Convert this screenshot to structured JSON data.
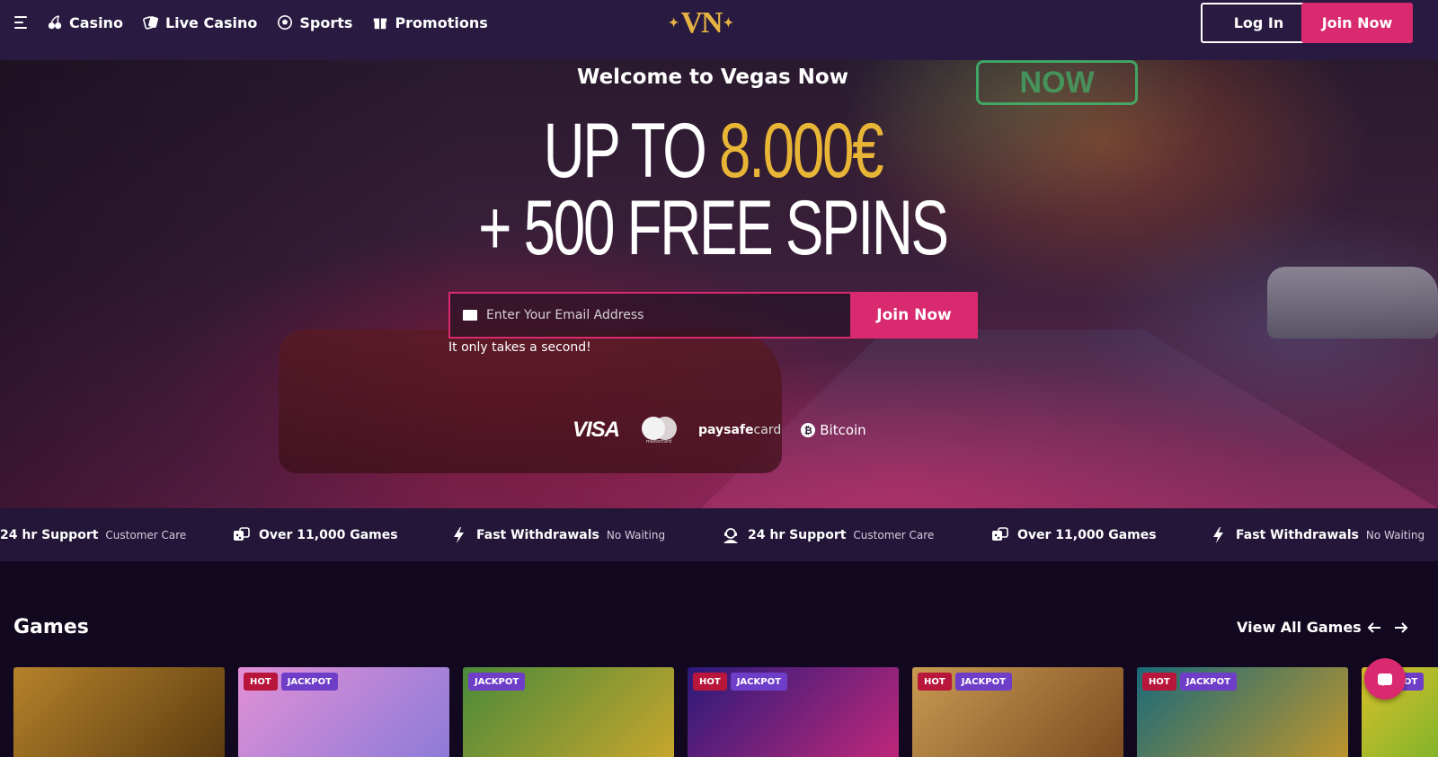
{
  "header": {
    "menu_icon": "hamburger-icon",
    "nav": [
      {
        "label": "Casino",
        "icon": "cherries-icon"
      },
      {
        "label": "Live Casino",
        "icon": "cards-icon"
      },
      {
        "label": "Sports",
        "icon": "soccer-ball-icon"
      },
      {
        "label": "Promotions",
        "icon": "gift-icon"
      }
    ],
    "logo": "VN",
    "login_label": "Log In",
    "join_label": "Join Now"
  },
  "hero": {
    "welcome": "Welcome to Vegas Now",
    "line1_prefix": "UP TO ",
    "line1_amount": "8.000€",
    "line2": "+ 500 FREE SPINS",
    "email_placeholder": "Enter Your Email Address",
    "join_label": "Join Now",
    "hint": "It only takes a second!",
    "neon_sign": "NOW",
    "payments": {
      "visa": "VISA",
      "mastercard": "mastercard",
      "paysafecard_bold": "paysafe",
      "paysafecard_light": "card",
      "bitcoin": "Bitcoin"
    }
  },
  "features": [
    {
      "title": "24 hr Support",
      "sub": "Customer Care",
      "icon": "support-agent-icon"
    },
    {
      "title": "Over 11,000 Games",
      "sub": "",
      "icon": "dice-icon"
    },
    {
      "title": "Fast Withdrawals",
      "sub": "No Waiting",
      "icon": "lightning-icon"
    },
    {
      "title": "24 hr Support",
      "sub": "Customer Care",
      "icon": "support-agent-icon"
    },
    {
      "title": "Over 11,000 Games",
      "sub": "",
      "icon": "dice-icon"
    },
    {
      "title": "Fast Withdrawals",
      "sub": "No Waiting",
      "icon": "lightning-icon"
    }
  ],
  "games": {
    "title": "Games",
    "view_all": "View All Games",
    "cards": [
      {
        "badges": [],
        "colors": [
          "#b5822b",
          "#5a3a10"
        ]
      },
      {
        "badges": [
          "HOT",
          "JACKPOT"
        ],
        "colors": [
          "#e290d6",
          "#8a7ad8"
        ]
      },
      {
        "badges": [
          "JACKPOT"
        ],
        "colors": [
          "#4a8a3a",
          "#caa62c"
        ]
      },
      {
        "badges": [
          "HOT",
          "JACKPOT"
        ],
        "colors": [
          "#2a1a7a",
          "#c2287a"
        ]
      },
      {
        "badges": [
          "HOT",
          "JACKPOT"
        ],
        "colors": [
          "#c89a52",
          "#7a4a20"
        ]
      },
      {
        "badges": [
          "HOT",
          "JACKPOT"
        ],
        "colors": [
          "#1a6a7a",
          "#c2962a"
        ]
      },
      {
        "badges": [
          "JACKPOT"
        ],
        "colors": [
          "#d8c02a",
          "#3aa82a"
        ]
      }
    ]
  },
  "colors": {
    "accent": "#d92a6f",
    "gold": "#e8b536",
    "header_bg": "#281a40"
  }
}
